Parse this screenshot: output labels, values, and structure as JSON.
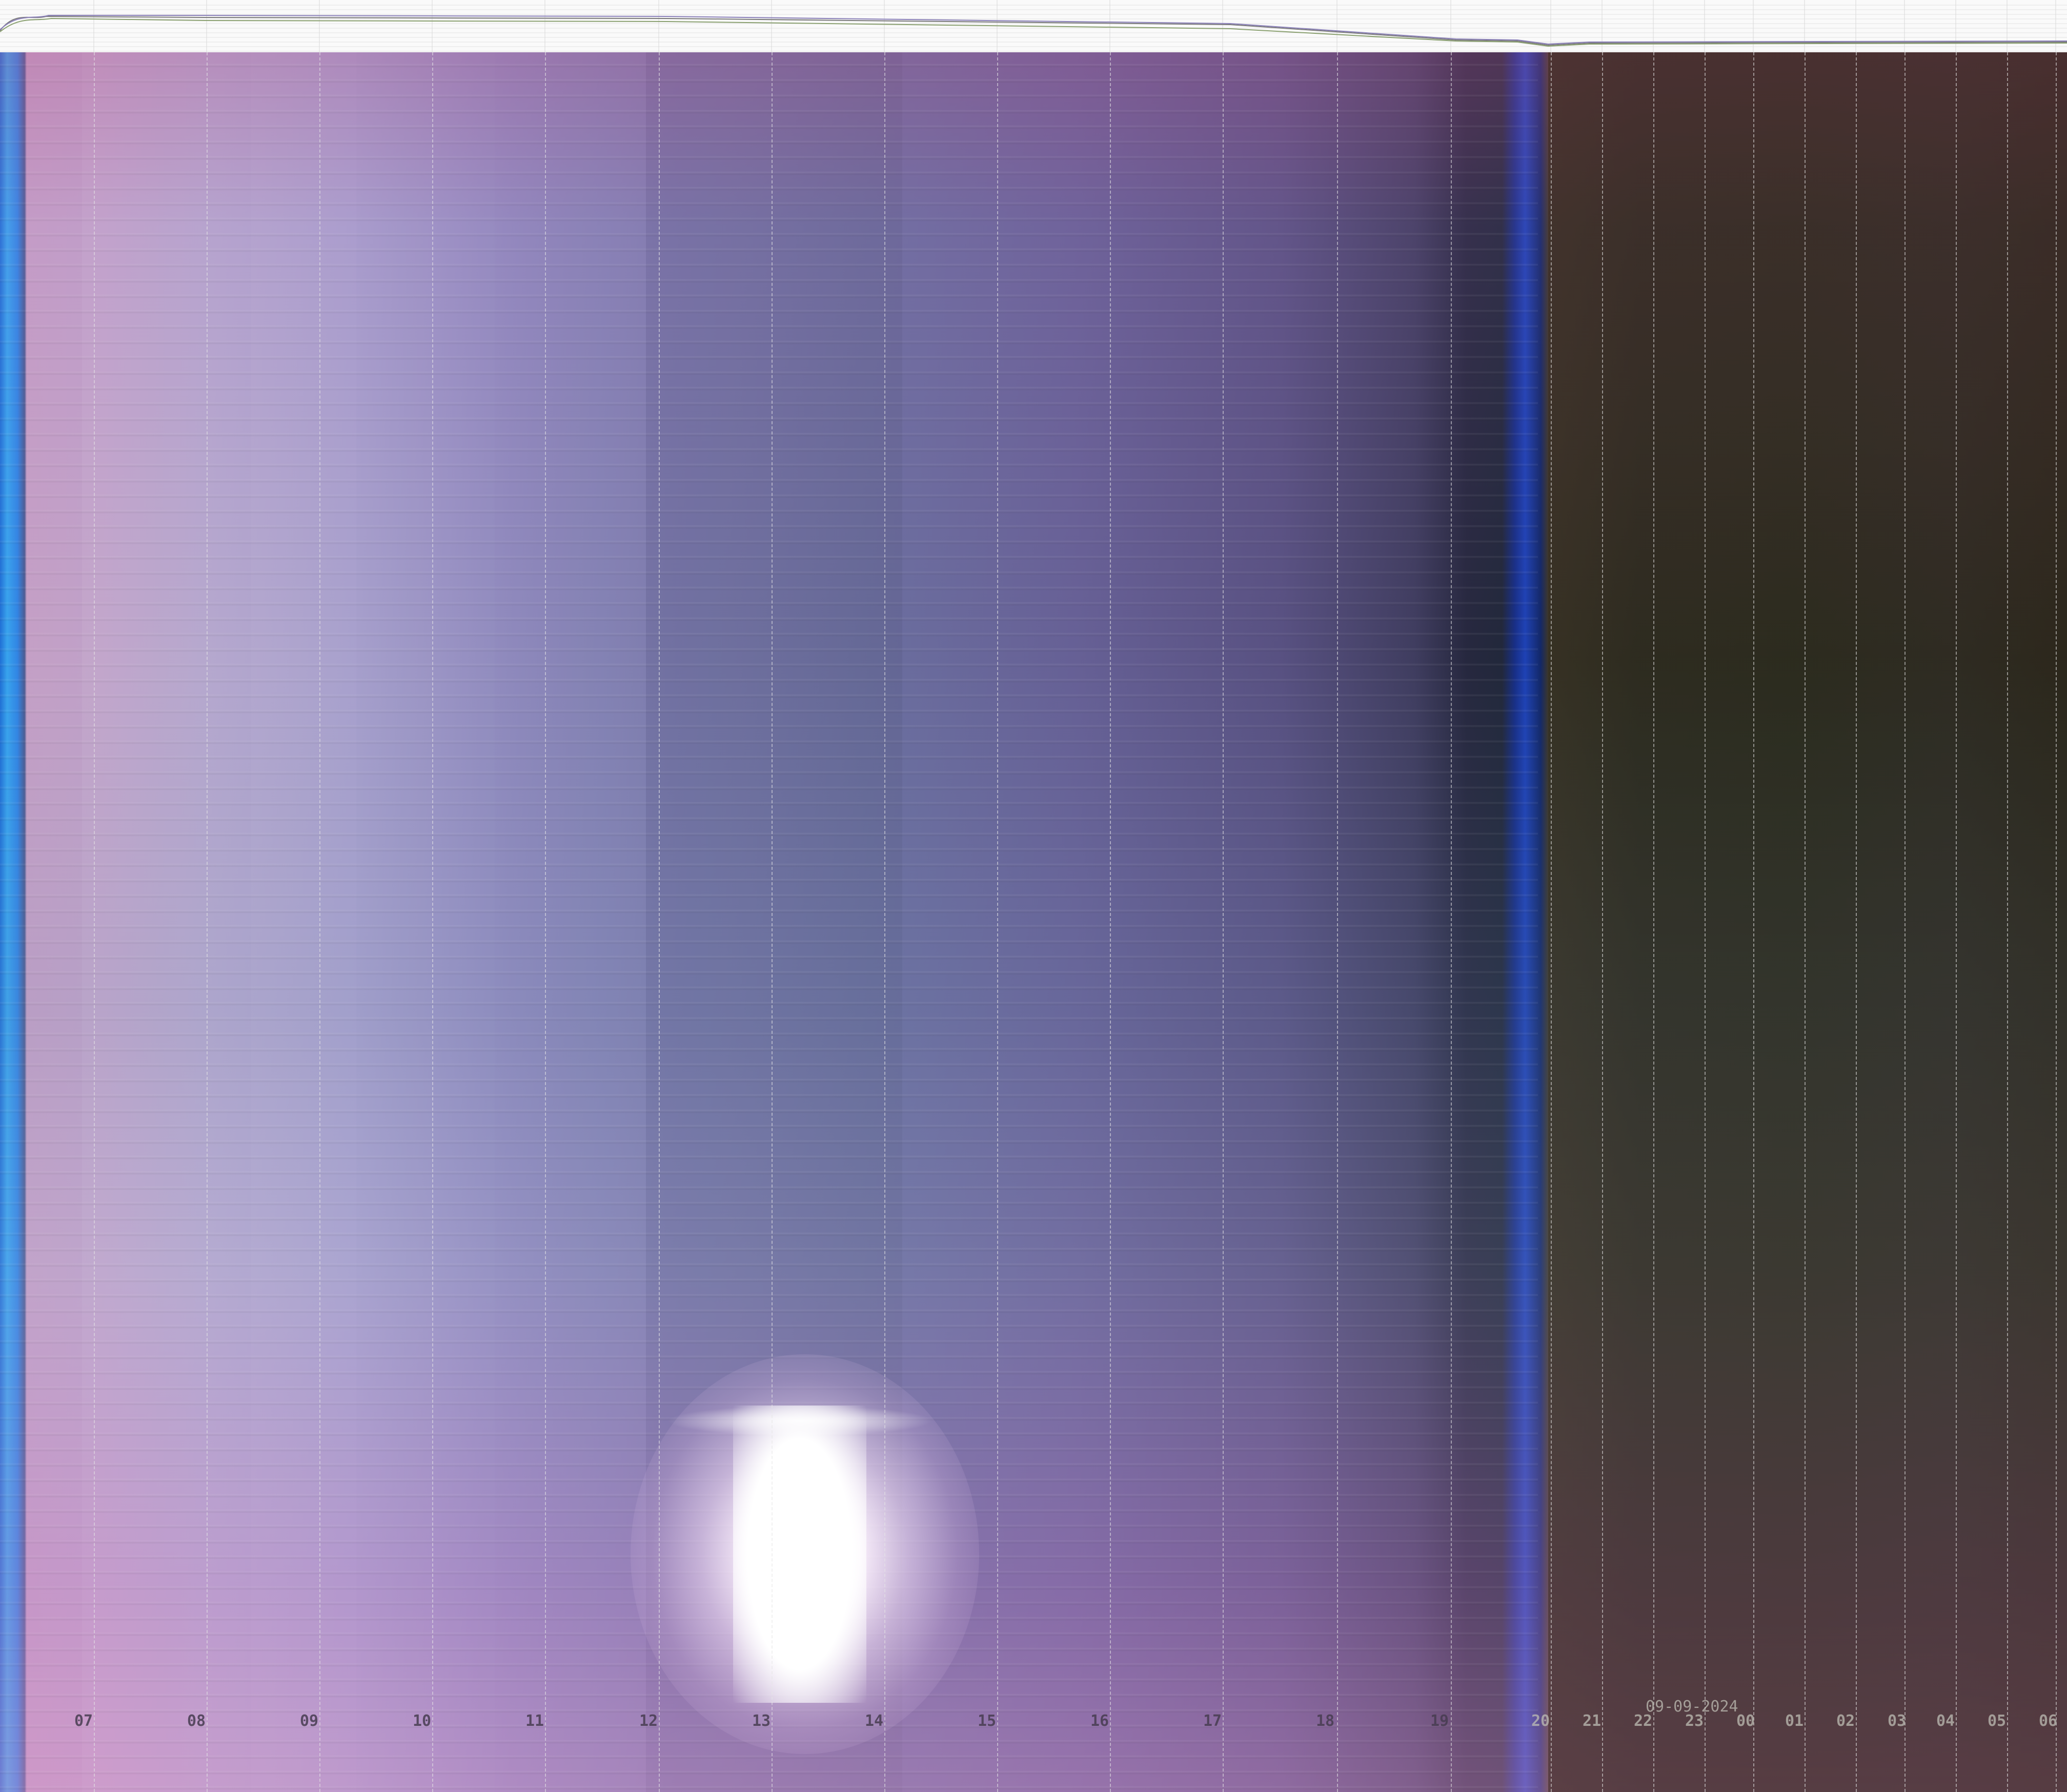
{
  "image": {
    "kind": "keogram",
    "date_label": "09-09-2024",
    "hour_labels": [
      "07",
      "08",
      "09",
      "10",
      "11",
      "12",
      "13",
      "14",
      "15",
      "16",
      "17",
      "18",
      "19",
      "20",
      "21",
      "22",
      "23",
      "00",
      "01",
      "02",
      "03",
      "04",
      "05",
      "06"
    ]
  },
  "colors": {
    "day_sky": "#8d86bc",
    "night_sky": "#2c2a1e",
    "twilight_blue": "#1b3fb6",
    "sun": "#ffffff",
    "grid_line": "#e6e6e6"
  }
}
